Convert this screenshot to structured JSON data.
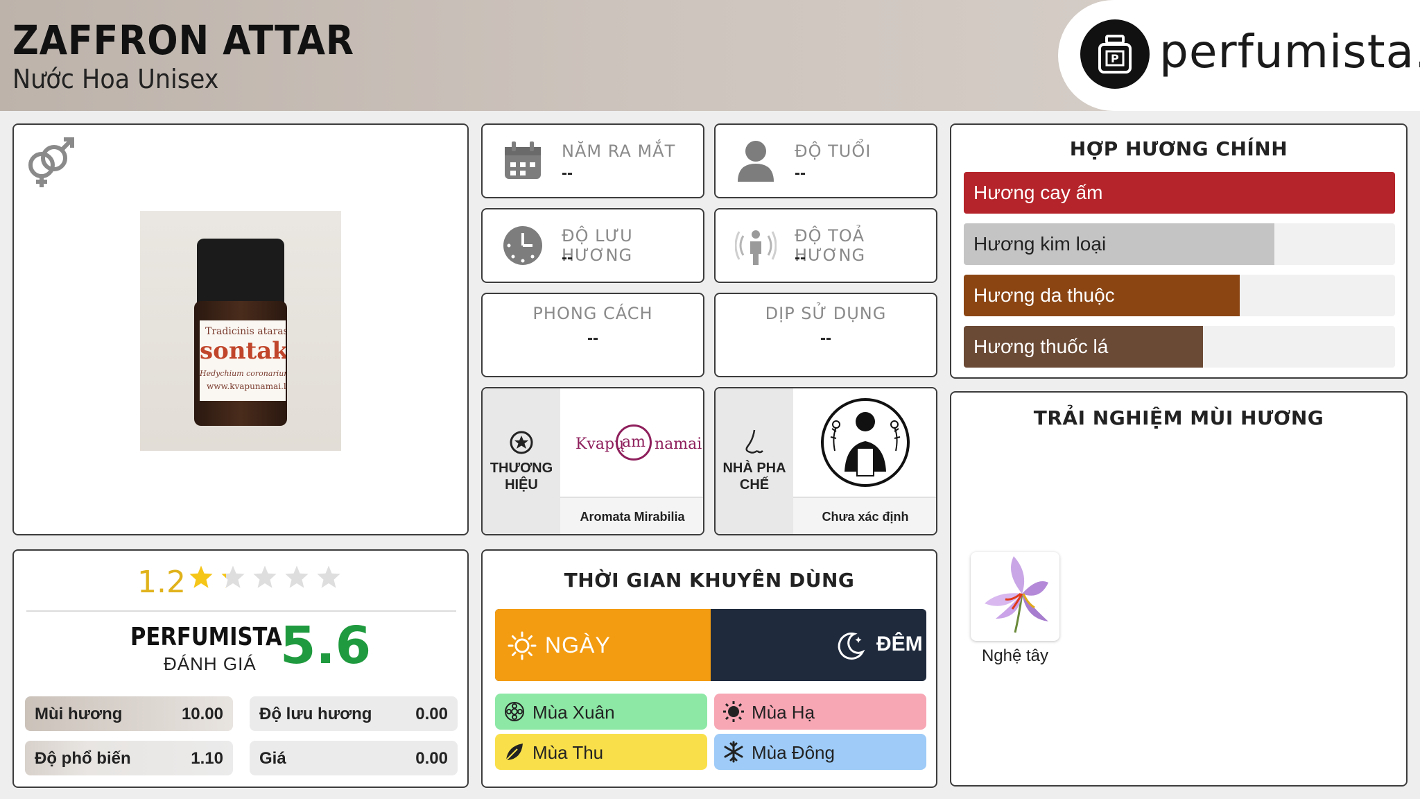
{
  "header": {
    "title": "ZAFFRON ATTAR",
    "subtitle": "Nước Hoa Unisex",
    "logo_text": "perfumista.vn"
  },
  "gender_icon": "unisex-gender-icon",
  "product_image": {
    "label_line1": "Tradicinis ataras",
    "label_line2": "sontaki",
    "label_line3": "Hedychium coronarium, kil",
    "label_line4": "www.kvapunamai.lt"
  },
  "info": {
    "launch_year": {
      "label": "NĂM RA MẮT",
      "value": "--",
      "icon": "calendar-icon"
    },
    "age": {
      "label": "ĐỘ TUỔI",
      "value": "--",
      "icon": "person-icon"
    },
    "longevity": {
      "label": "ĐỘ LƯU HƯƠNG",
      "value": "--",
      "icon": "clock-icon"
    },
    "sillage": {
      "label": "ĐỘ TOẢ HƯƠNG",
      "value": "--",
      "icon": "sillage-icon"
    },
    "style": {
      "label": "PHONG CÁCH",
      "value": "--"
    },
    "occasion": {
      "label": "DỊP SỬ DỤNG",
      "value": "--"
    }
  },
  "brand": {
    "label_line1": "THƯƠNG",
    "label_line2": "HIỆU",
    "logo_left": "Kvapų",
    "logo_mid": "am",
    "logo_right": "namai",
    "name": "Aromata Mirabilia"
  },
  "perfumer": {
    "label_line1": "NHÀ PHA",
    "label_line2": "CHẾ",
    "name": "Chưa xác định"
  },
  "accords": {
    "title": "HỢP HƯƠNG CHÍNH",
    "items": [
      {
        "label": "Hương cay ấm",
        "percent": 100,
        "color": "#b5242a"
      },
      {
        "label": "Hương kim loại",
        "percent": 72,
        "color": "#c4c4c4",
        "text_color": "#222222"
      },
      {
        "label": "Hương da thuộc",
        "percent": 64,
        "color": "#8b4513"
      },
      {
        "label": "Hương thuốc lá",
        "percent": 55.5,
        "color": "#6b4a35"
      }
    ]
  },
  "experience": {
    "title": "TRẢI NGHIỆM MÙI HƯƠNG",
    "notes": [
      {
        "name": "Nghệ tây",
        "icon": "saffron-flower-icon"
      }
    ]
  },
  "rating": {
    "score": "1.2",
    "stars_filled": 1.2,
    "stars_total": 5,
    "perfumista_label": "PERFUMISTA",
    "perfumista_sub": "ĐÁNH GIÁ",
    "perfumista_score": "5.6",
    "stats": [
      {
        "label": "Mùi hương",
        "value": "10.00"
      },
      {
        "label": "Độ lưu hương",
        "value": "0.00"
      },
      {
        "label": "Độ phổ biến",
        "value": "1.10"
      },
      {
        "label": "Giá",
        "value": "0.00"
      }
    ]
  },
  "time": {
    "title": "THỜI GIAN KHUYÊN DÙNG",
    "day": {
      "label": "NGÀY",
      "color": "#f39c12",
      "percent": 50
    },
    "night": {
      "label": "ĐÊM",
      "color": "#1f2a3d"
    },
    "seasons": [
      {
        "label": "Mùa Xuân",
        "color": "#8de8a6",
        "icon": "spring-flower-icon"
      },
      {
        "label": "Mùa Hạ",
        "color": "#f7a6b4",
        "icon": "sun-icon"
      },
      {
        "label": "Mùa Thu",
        "color": "#f9e04b",
        "icon": "leaf-icon"
      },
      {
        "label": "Mùa Đông",
        "color": "#9ecbf7",
        "icon": "snowflake-icon"
      }
    ]
  }
}
